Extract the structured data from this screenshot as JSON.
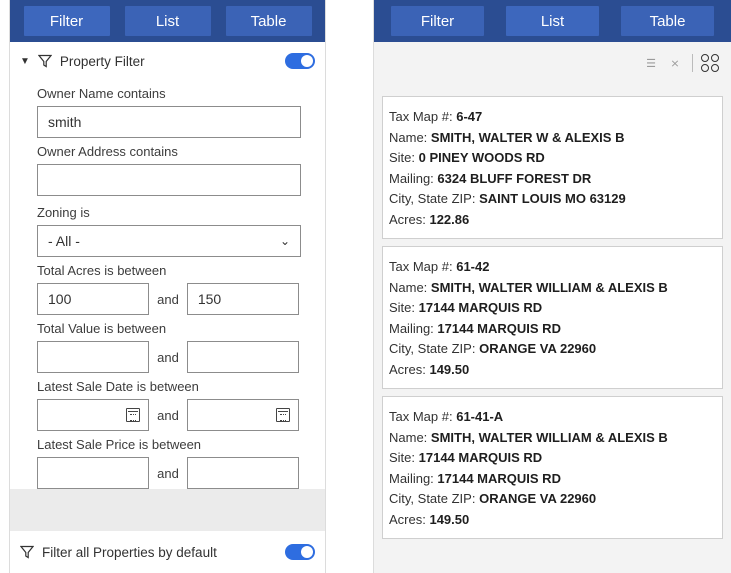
{
  "tabs": {
    "filter": "Filter",
    "list": "List",
    "table": "Table"
  },
  "property_filter": {
    "title": "Property Filter",
    "enabled": true,
    "owner_name": {
      "label": "Owner Name contains",
      "value": "smith"
    },
    "owner_address": {
      "label": "Owner Address contains",
      "value": ""
    },
    "zoning": {
      "label": "Zoning is",
      "value": "- All -"
    },
    "total_acres": {
      "label": "Total Acres is between",
      "min": "100",
      "and": "and",
      "max": "150"
    },
    "total_value": {
      "label": "Total Value is between",
      "min": "",
      "and": "and",
      "max": ""
    },
    "sale_date": {
      "label": "Latest Sale Date is between",
      "min": "",
      "and": "and",
      "max": ""
    },
    "sale_price": {
      "label": "Latest Sale Price is between",
      "min": "",
      "and": "and",
      "max": ""
    }
  },
  "footer": {
    "label": "Filter all Properties by default",
    "enabled": true
  },
  "results": [
    {
      "tax_map_label": "Tax Map #:",
      "tax_map": "6-47",
      "name_label": "Name:",
      "name": "SMITH, WALTER W & ALEXIS B",
      "site_label": "Site:",
      "site": "0 PINEY WOODS RD",
      "mailing_label": "Mailing:",
      "mailing": "6324 BLUFF FOREST DR",
      "city_label": "City, State ZIP:",
      "city": "SAINT LOUIS MO 63129",
      "acres_label": "Acres:",
      "acres": "122.86"
    },
    {
      "tax_map_label": "Tax Map #:",
      "tax_map": "61-42",
      "name_label": "Name:",
      "name": "SMITH, WALTER WILLIAM & ALEXIS B",
      "site_label": "Site:",
      "site": "17144 MARQUIS RD",
      "mailing_label": "Mailing:",
      "mailing": "17144 MARQUIS RD",
      "city_label": "City, State ZIP:",
      "city": "ORANGE VA 22960",
      "acres_label": "Acres:",
      "acres": "149.50"
    },
    {
      "tax_map_label": "Tax Map #:",
      "tax_map": "61-41-A",
      "name_label": "Name:",
      "name": "SMITH, WALTER WILLIAM & ALEXIS B",
      "site_label": "Site:",
      "site": "17144 MARQUIS RD",
      "mailing_label": "Mailing:",
      "mailing": "17144 MARQUIS RD",
      "city_label": "City, State ZIP:",
      "city": "ORANGE VA 22960",
      "acres_label": "Acres:",
      "acres": "149.50"
    }
  ],
  "icons": {
    "funnel": "funnel-icon",
    "calendar": "calendar-icon",
    "select_all": "select-all-icon",
    "clear_selection": "clear-selection-icon",
    "options": "options-grid-icon"
  },
  "colors": {
    "tab_bar": "#2b4d92",
    "tab": "#3b63b6",
    "toggle": "#2e6de0"
  }
}
